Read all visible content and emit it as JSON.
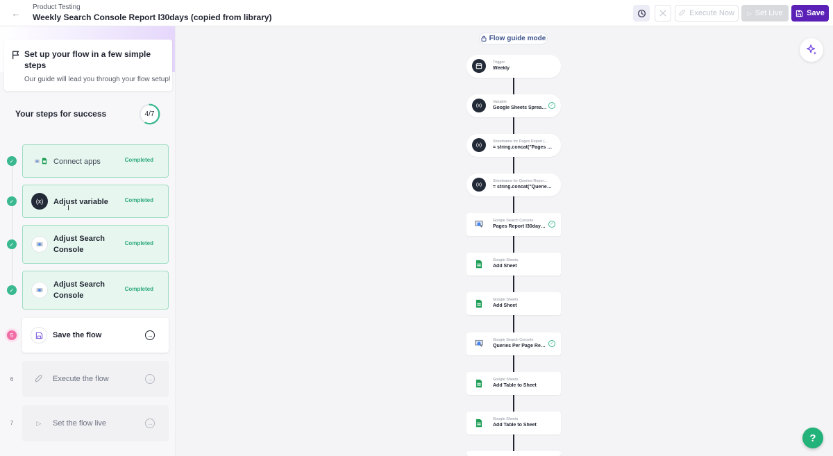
{
  "header": {
    "project": "Product Testing",
    "title": "Weekly Search Console Report l30days (copied from library)",
    "execute_label": "Execute Now",
    "set_live_label": "Set Live",
    "save_label": "Save"
  },
  "guide": {
    "title": "Set up your flow in a few simple steps",
    "subtitle": "Our guide will lead you through your flow setup!",
    "steps_title": "Your steps for success",
    "progress": "4/7",
    "progress_fraction": 0.571,
    "steps": [
      {
        "number": "",
        "label": "Connect apps",
        "status": "Completed"
      },
      {
        "number": "",
        "label": "Adjust variable",
        "status": "Completed"
      },
      {
        "number": "",
        "label": "Adjust Search Console",
        "status": "Completed"
      },
      {
        "number": "",
        "label": "Adjust Search Console",
        "status": "Completed"
      },
      {
        "number": "5",
        "label": "Save the flow",
        "status": ""
      },
      {
        "number": "6",
        "label": "Execute the flow",
        "status": ""
      },
      {
        "number": "7",
        "label": "Set the flow live",
        "status": ""
      }
    ]
  },
  "canvas": {
    "mode_badge": "Flow guide mode",
    "nodes": [
      {
        "sup": "Trigger",
        "main": "Weekly"
      },
      {
        "sup": "Variable",
        "main": "Google Sheets Spread..."
      },
      {
        "sup": "Sheetname for Pages Report (...",
        "main": "= string.concat(\"Pages \", d..."
      },
      {
        "sup": "Sheetname for Queries Report ...",
        "main": "= string.concat(\"Queries \",..."
      },
      {
        "sup": "Google Search Console",
        "main": "Pages Report l30days (S..."
      },
      {
        "sup": "Google Sheets",
        "main": "Add Sheet"
      },
      {
        "sup": "Google Sheets",
        "main": "Add Sheet"
      },
      {
        "sup": "Google Search Console",
        "main": "Queries Per Page Report ..."
      },
      {
        "sup": "Google Sheets",
        "main": "Add Table to Sheet"
      },
      {
        "sup": "Google Sheets",
        "main": "Add Table to Sheet"
      }
    ]
  },
  "help_label": "?",
  "colors": {
    "accent": "#5b21b6",
    "success": "#3ab88f",
    "current_step": "#f06da6",
    "help": "#22b27a"
  }
}
